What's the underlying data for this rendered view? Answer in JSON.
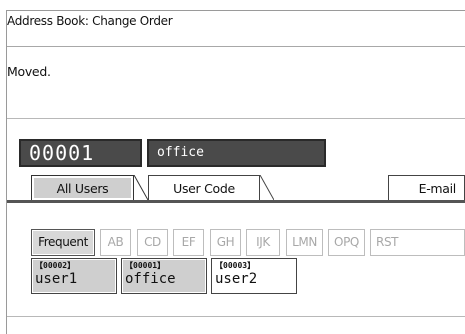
{
  "window": {
    "title": "Address Book: Change Order"
  },
  "message": {
    "text": "Moved."
  },
  "selection": {
    "number": "00001",
    "name": "office"
  },
  "tabs": [
    {
      "label": "All Users",
      "active": true
    },
    {
      "label": "User Code",
      "active": false
    },
    {
      "label": "E-mail",
      "active": false
    }
  ],
  "filters": [
    {
      "label": "Frequent",
      "active": true
    },
    {
      "label": "AB",
      "active": false
    },
    {
      "label": "CD",
      "active": false
    },
    {
      "label": "EF",
      "active": false
    },
    {
      "label": "GH",
      "active": false
    },
    {
      "label": "IJK",
      "active": false
    },
    {
      "label": "LMN",
      "active": false
    },
    {
      "label": "OPQ",
      "active": false
    },
    {
      "label": "RST",
      "active": false
    }
  ],
  "entries": [
    {
      "id": "【00002】",
      "name": "user1",
      "selected": true
    },
    {
      "id": "【00001】",
      "name": "office",
      "selected": true
    },
    {
      "id": "【00003】",
      "name": "user2",
      "selected": false
    }
  ]
}
